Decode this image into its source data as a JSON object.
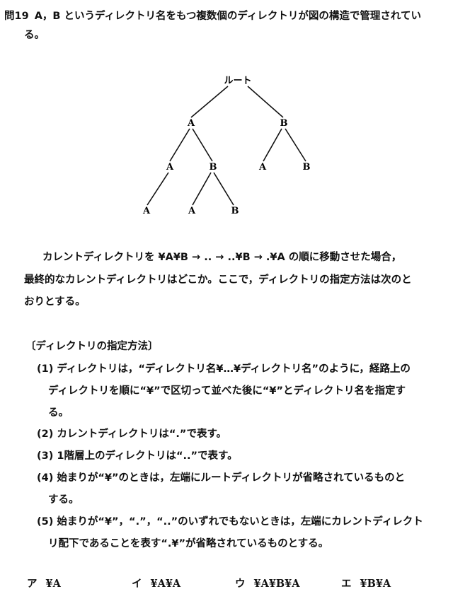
{
  "question": {
    "number": "問19",
    "text_line1": "A，B というディレクトリ名をもつ複数個のディレクトリが図の構造で管理されてい",
    "text_line2": "る。"
  },
  "tree": {
    "root": "ルート",
    "n1": "A",
    "n2": "B",
    "n3": "A",
    "n4": "B",
    "n5": "A",
    "n6": "B",
    "n7": "A",
    "n8": "A",
    "n9": "B"
  },
  "body": {
    "line1": "カレントディレクトリを ¥A¥B → .. → ..¥B → .¥A の順に移動させた場合，",
    "line2": "最終的なカレントディレクトリはどこか。ここで，ディレクトリの指定方法は次のと",
    "line3": "おりとする。"
  },
  "spec": {
    "heading": "〔ディレクトリの指定方法〕",
    "item1_l1": "(1)  ディレクトリは，“ディレクトリ名¥…¥ディレクトリ名”のように，経路上の",
    "item1_l2": "ディレクトリを順に“¥”で区切って並べた後に“¥”とディレクトリ名を指定す",
    "item1_l3": "る。",
    "item2": "(2)  カレントディレクトリは“.”で表す。",
    "item3": "(3)  1階層上のディレクトリは“..”で表す。",
    "item4_l1": "(4)  始まりが“¥”のときは，左端にルートディレクトリが省略されているものと",
    "item4_l2": "する。",
    "item5_l1": "(5)  始まりが“¥”，“.”，“..”のいずれでもないときは，左端にカレントディレクト",
    "item5_l2": "リ配下であることを表す“.¥”が省略されているものとする。"
  },
  "choices": [
    {
      "key": "ア",
      "value": "¥A"
    },
    {
      "key": "イ",
      "value": "¥A¥A"
    },
    {
      "key": "ウ",
      "value": "¥A¥B¥A"
    },
    {
      "key": "エ",
      "value": "¥B¥A"
    }
  ]
}
